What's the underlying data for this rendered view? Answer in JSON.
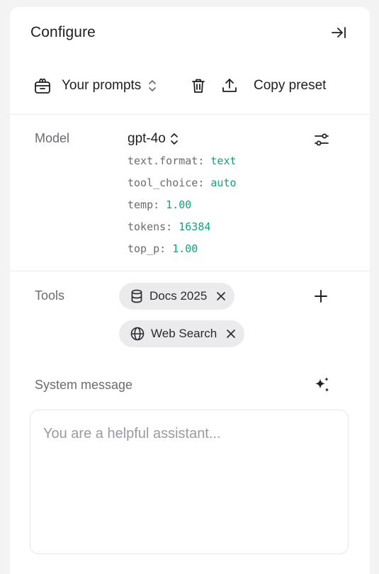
{
  "header": {
    "title": "Configure",
    "collapse_icon": "collapse-right-icon"
  },
  "toolbar": {
    "prompts_label": "Your prompts",
    "copy_preset_label": "Copy preset",
    "icons": [
      "prompts-box-icon",
      "chevron-updown-icon",
      "trash-icon",
      "upload-icon"
    ]
  },
  "model": {
    "section_label": "Model",
    "name": "gpt-4o",
    "params": [
      {
        "key": "text.format:",
        "value": "text"
      },
      {
        "key": "tool_choice:",
        "value": "auto"
      },
      {
        "key": "temp:",
        "value": "1.00"
      },
      {
        "key": "tokens:",
        "value": "16384"
      },
      {
        "key": "top_p:",
        "value": "1.00"
      }
    ]
  },
  "tools": {
    "section_label": "Tools",
    "items": [
      {
        "label": "Docs 2025",
        "icon": "database-icon"
      },
      {
        "label": "Web Search",
        "icon": "globe-icon"
      }
    ]
  },
  "system": {
    "section_label": "System message",
    "placeholder": "You are a helpful assistant..."
  },
  "colors": {
    "accent_value": "#10a37f",
    "muted_text": "#6b6b73",
    "chip_bg": "#ebebee"
  }
}
